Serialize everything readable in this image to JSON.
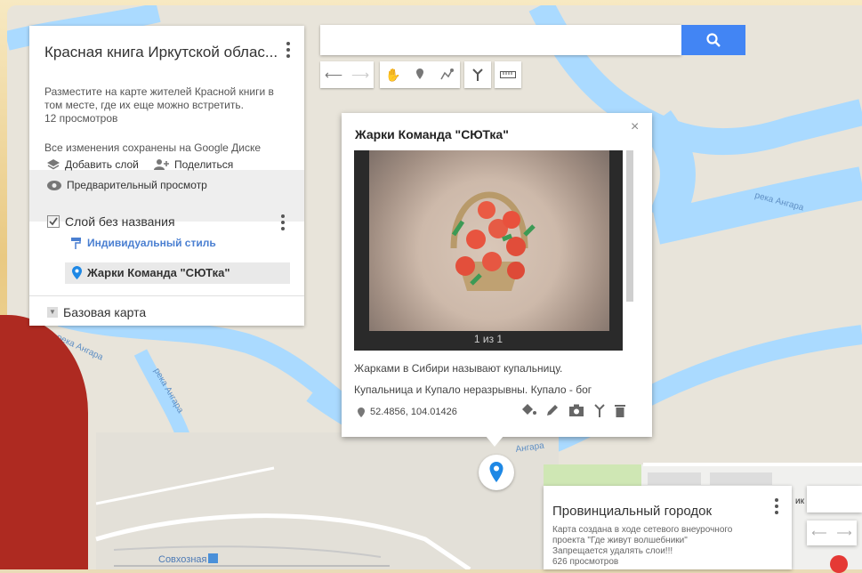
{
  "left_panel": {
    "title": "Красная книга Иркутской облас...",
    "description": "Разместите на карте жителей Красной книги в том месте, где их еще можно встретить.",
    "views": "12 просмотров",
    "saved_status": "Все изменения сохранены на Google Диске",
    "add_layer": "Добавить слой",
    "share": "Поделиться",
    "preview": "Предварительный просмотр",
    "layer_name": "Слой без названия",
    "layer_style": "Индивидуальный стиль",
    "layer_item": "Жарки Команда \"СЮТка\"",
    "base_map": "Базовая карта"
  },
  "search": {
    "placeholder": ""
  },
  "popup": {
    "title": "Жарки Команда \"СЮТка\"",
    "image_counter": "1 из 1",
    "text_line1": "Жарками в Сибири называют купальницу.",
    "text_line2": "Купальница и Купало неразрывны. Купало - бог",
    "coords": "52.4856, 104.01426"
  },
  "map_labels": {
    "river1": "река Ангара",
    "river2": "река Ангара",
    "river3": "река Ангара",
    "river4": "Ангара",
    "station": "Совхозная",
    "partial": "ик"
  },
  "second_panel": {
    "title": "Провинциальный городок",
    "desc1": "Карта создана в ходе сетевого внеурочного",
    "desc2": "проекта \"Где живут волшебники\"",
    "desc3": "Запрещается удалять слои!!!",
    "views": "626 просмотров"
  },
  "colors": {
    "water": "#aadaff",
    "land": "#e8e4da",
    "accent": "#4285f4",
    "pin": "#1e88e5",
    "red": "#ae2a21"
  }
}
